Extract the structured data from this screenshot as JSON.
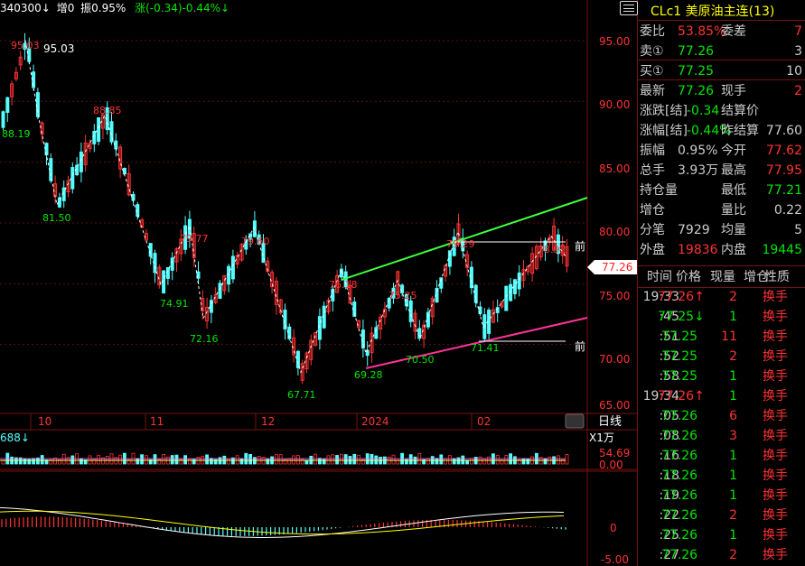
{
  "topbar": {
    "code": "340300↓",
    "inc": "增0",
    "amp": "振0.95%",
    "chg": "涨(-0.34)-0.44%↓"
  },
  "price_axis": {
    "labels": [
      "95.00",
      "90.00",
      "85.00",
      "80.00",
      "75.00",
      "70.00",
      "65.00"
    ],
    "current": "77.26"
  },
  "date_axis": {
    "labels": [
      "10",
      "11",
      "12",
      "2024",
      "02"
    ],
    "period": "日线"
  },
  "peak_labels": [
    {
      "text": "95.03",
      "color": "red"
    },
    {
      "text": "95.03",
      "color": "white"
    },
    {
      "text": "88.19",
      "color": "green"
    },
    {
      "text": "88.85",
      "color": "red"
    },
    {
      "text": "81.50",
      "color": "green"
    },
    {
      "text": "79.77",
      "color": "red"
    },
    {
      "text": "79.60",
      "color": "red"
    },
    {
      "text": "74.91",
      "color": "green"
    },
    {
      "text": "72.16",
      "color": "green"
    },
    {
      "text": "76.18",
      "color": "red"
    },
    {
      "text": "75.25",
      "color": "red"
    },
    {
      "text": "67.71",
      "color": "green"
    },
    {
      "text": "69.28",
      "color": "green"
    },
    {
      "text": "70.50",
      "color": "green"
    },
    {
      "text": "79.29",
      "color": "red"
    },
    {
      "text": "71.41",
      "color": "green"
    },
    {
      "text": "78.92",
      "color": "red"
    }
  ],
  "front_labels": [
    "前",
    "前"
  ],
  "volume": {
    "label": "688↓",
    "unit": "X1万",
    "values": [
      "54.69",
      "0.00"
    ]
  },
  "macd": {
    "values": [
      "0",
      "-5.00"
    ]
  },
  "panel": {
    "title": "CLc1 美原油主连(13)",
    "rows": [
      {
        "l1": "委比",
        "v1": "53.85%",
        "l2": "委差",
        "v2": "7"
      },
      {
        "l1": "卖①",
        "v1": "77.26",
        "l2": "",
        "v2": "3"
      },
      {
        "l1": "买①",
        "v1": "77.25",
        "l2": "",
        "v2": "10"
      },
      {
        "l1": "最新",
        "v1": "77.26",
        "l2": "现手",
        "v2": "2"
      },
      {
        "l1": "涨跌[结]",
        "v1": "-0.34",
        "l2": "结算价",
        "v2": ""
      },
      {
        "l1": "涨幅[结]",
        "v1": "-0.44%",
        "l2": "昨结算",
        "v2": "77.60"
      },
      {
        "l1": "振幅",
        "v1": "0.95%",
        "l2": "今开",
        "v2": "77.62"
      },
      {
        "l1": "总手",
        "v1": "3.93万",
        "l2": "最高",
        "v2": "77.95"
      },
      {
        "l1": "持仓量",
        "v1": "",
        "l2": "最低",
        "v2": "77.21"
      },
      {
        "l1": "增仓",
        "v1": "",
        "l2": "量比",
        "v2": "0.22"
      },
      {
        "l1": "分笔",
        "v1": "7929",
        "l2": "均量",
        "v2": "5"
      },
      {
        "l1": "外盘",
        "v1": "19836",
        "l2": "内盘",
        "v2": "19445"
      }
    ],
    "tick_header": {
      "time": "时间",
      "price": "价格",
      "vol": "现量",
      "inc": "增仓",
      "nature": "性质"
    },
    "ticks": [
      {
        "time": "19:33",
        "price": "77.26↑",
        "vol": "2",
        "nature": "换手"
      },
      {
        "time": ":45",
        "price": "77.25↓",
        "vol": "1",
        "nature": "换手"
      },
      {
        "time": ":51",
        "price": "77.25",
        "vol": "11",
        "nature": "换手"
      },
      {
        "time": ":52",
        "price": "77.25",
        "vol": "2",
        "nature": "换手"
      },
      {
        "time": ":58",
        "price": "77.25",
        "vol": "1",
        "nature": "换手"
      },
      {
        "time": "19:34",
        "price": "77.26↑",
        "vol": "1",
        "nature": "换手"
      },
      {
        "time": ":05",
        "price": "77.26",
        "vol": "6",
        "nature": "换手"
      },
      {
        "time": ":08",
        "price": "77.26",
        "vol": "3",
        "nature": "换手"
      },
      {
        "time": ":16",
        "price": "77.26",
        "vol": "1",
        "nature": "换手"
      },
      {
        "time": ":18",
        "price": "77.26",
        "vol": "1",
        "nature": "换手"
      },
      {
        "time": ":19",
        "price": "77.26",
        "vol": "1",
        "nature": "换手"
      },
      {
        "time": ":22",
        "price": "77.26",
        "vol": "2",
        "nature": "换手"
      },
      {
        "time": ":25",
        "price": "77.26",
        "vol": "1",
        "nature": "换手"
      },
      {
        "time": ":27",
        "price": "77.26",
        "vol": "2",
        "nature": "换手"
      }
    ]
  },
  "colors": {
    "up": "#ff3232",
    "down": "#54ffff",
    "accent_green": "#00e600",
    "trend_green": "#40ff40",
    "trend_pink": "#ff3399",
    "frame": "#7a1010",
    "text_yellow": "#ffff00",
    "text_red": "#ff3232",
    "text_green": "#00e600"
  }
}
